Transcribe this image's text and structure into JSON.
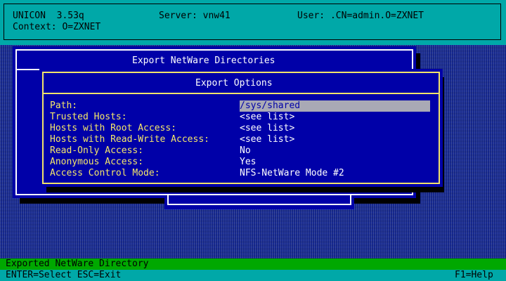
{
  "header": {
    "app": "UNICON  3.53q",
    "server": "Server: vnw41",
    "user": "User: .CN=admin.O=ZXNET",
    "context": "Context: O=ZXNET"
  },
  "outer_dialog": {
    "title": "Export NetWare Directories"
  },
  "options_dialog": {
    "title": "Export Options",
    "fields": [
      {
        "label": "Path:",
        "value": "/sys/shared",
        "selected": true
      },
      {
        "label": "Trusted Hosts:",
        "value": "<see list>"
      },
      {
        "label": "Hosts with Root Access:",
        "value": "<see list>"
      },
      {
        "label": "Hosts with Read-Write Access:",
        "value": "<see list>"
      },
      {
        "label": "Read-Only Access:",
        "value": "No"
      },
      {
        "label": "Anonymous Access:",
        "value": "Yes"
      },
      {
        "label": "Access Control Mode:",
        "value": "NFS-NetWare Mode #2"
      }
    ]
  },
  "status_bar": {
    "text": "Exported NetWare Directory"
  },
  "footer": {
    "keys": "ENTER=Select ESC=Exit",
    "help": "F1=Help"
  },
  "colors": {
    "background": "#1a30a8",
    "header": "#00a8a8",
    "dialog": "#0000a8",
    "label": "#f5e76a",
    "selection": "#a9a9b5",
    "status": "#00a800"
  }
}
